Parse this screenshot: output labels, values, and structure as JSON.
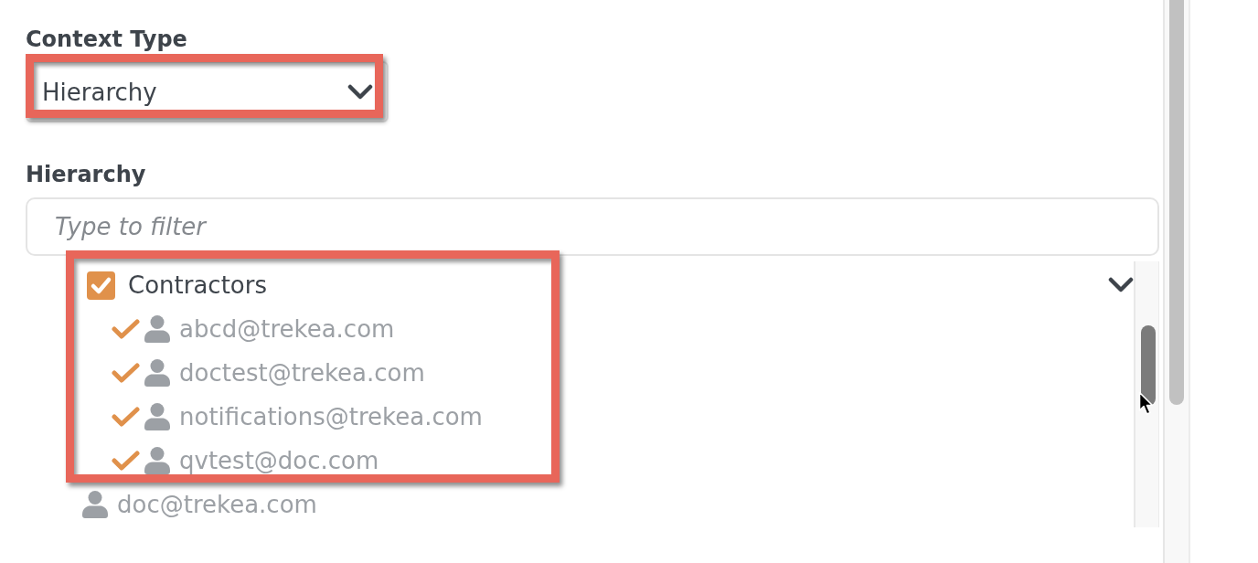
{
  "context_type": {
    "label": "Context Type",
    "select": {
      "value": "Hierarchy"
    }
  },
  "hierarchy": {
    "label": "Hierarchy",
    "filter": {
      "placeholder": "Type to filter"
    },
    "tree": [
      {
        "kind": "group",
        "label": "Contractors",
        "checked": true,
        "expanded": true,
        "children": [
          {
            "kind": "user",
            "label": "abcd@trekea.com",
            "checked": true
          },
          {
            "kind": "user",
            "label": "doctest@trekea.com",
            "checked": true
          },
          {
            "kind": "user",
            "label": "notifications@trekea.com",
            "checked": true
          },
          {
            "kind": "user",
            "label": "qvtest@doc.com",
            "checked": true
          }
        ]
      },
      {
        "kind": "user",
        "label": "doc@trekea.com",
        "checked": false
      }
    ]
  }
}
